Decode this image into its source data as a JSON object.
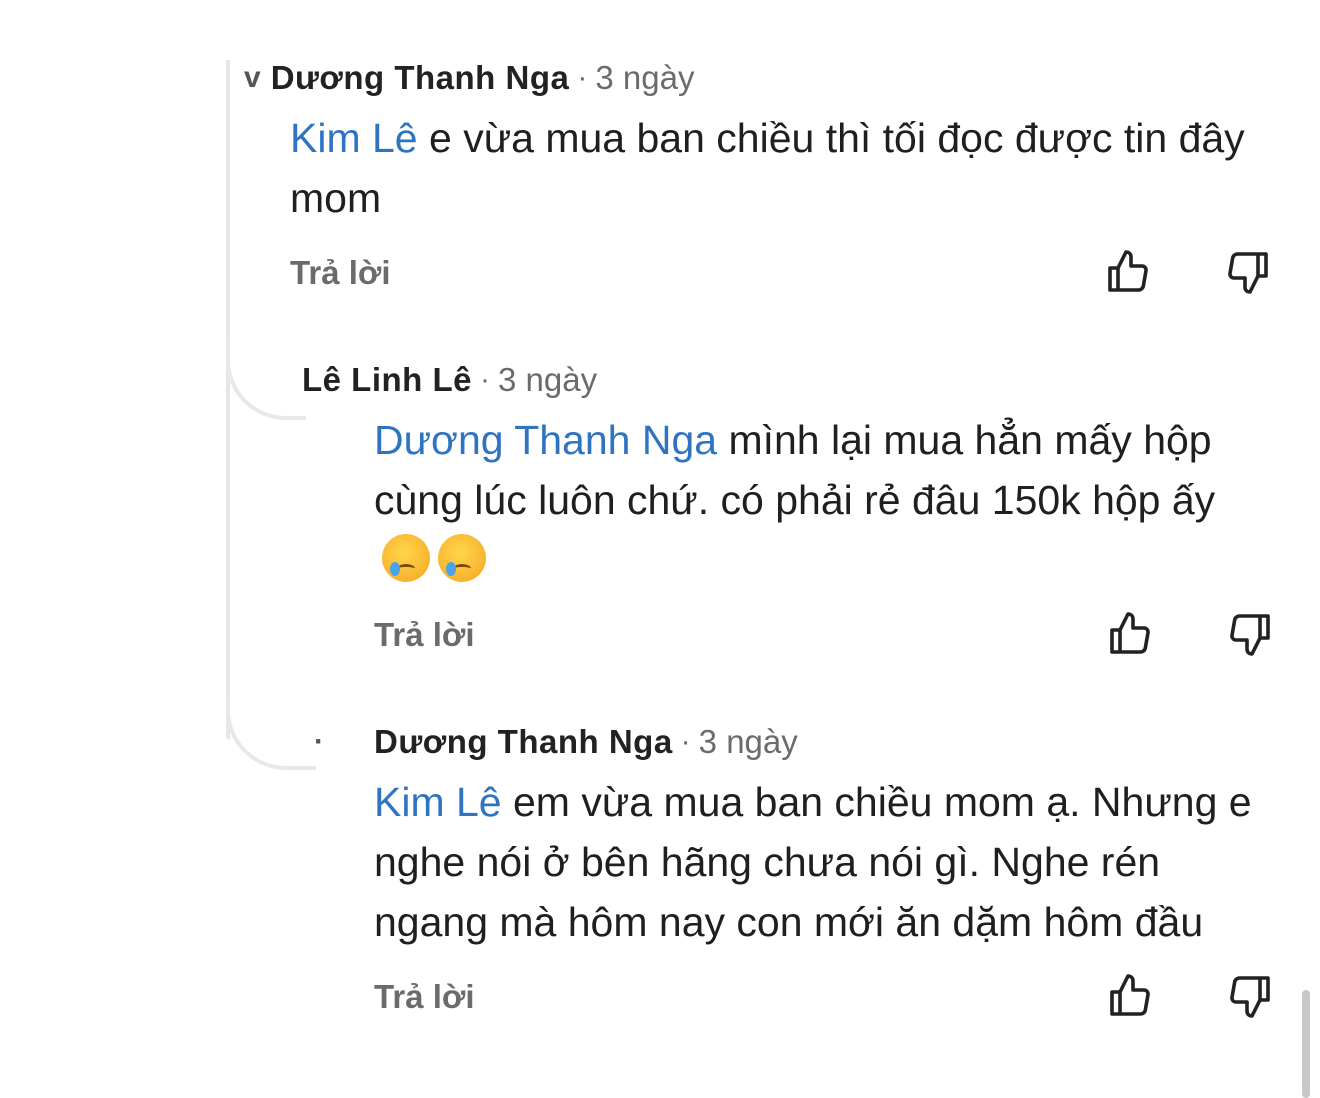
{
  "comments": [
    {
      "avatar": "v",
      "author": "Dương Thanh Nga",
      "separator": "·",
      "time": "3 ngày",
      "mention": "Kim Lê",
      "text": " e vừa mua ban chiều thì tối đọc được tin đây mom",
      "reply_label": "Trả lời"
    },
    {
      "avatar": "",
      "author": "Lê Linh Lê",
      "separator": "·",
      "time": "3 ngày",
      "mention": "Dương Thanh Nga",
      "text": " mình lại mua hẳn mấy hộp cùng lúc luôn chứ. có phải rẻ đâu 150k hộp ấy",
      "reply_label": "Trả lời"
    },
    {
      "avatar": "·",
      "author": "Dương Thanh Nga",
      "separator": "·",
      "time": "3 ngày",
      "mention": "Kim Lê",
      "text": " em vừa mua ban chiều mom ạ. Nhưng e nghe nói ở bên hãng chưa nói gì. Nghe rén ngang mà hôm nay con mới ăn dặm hôm đầu",
      "reply_label": "Trả lời"
    }
  ],
  "icons": {
    "like": "thumbs-up-icon",
    "dislike": "thumbs-down-icon",
    "emoji": "crying-face-emoji"
  },
  "colors": {
    "mention": "#2f74c0",
    "meta": "#6b6b6b"
  }
}
